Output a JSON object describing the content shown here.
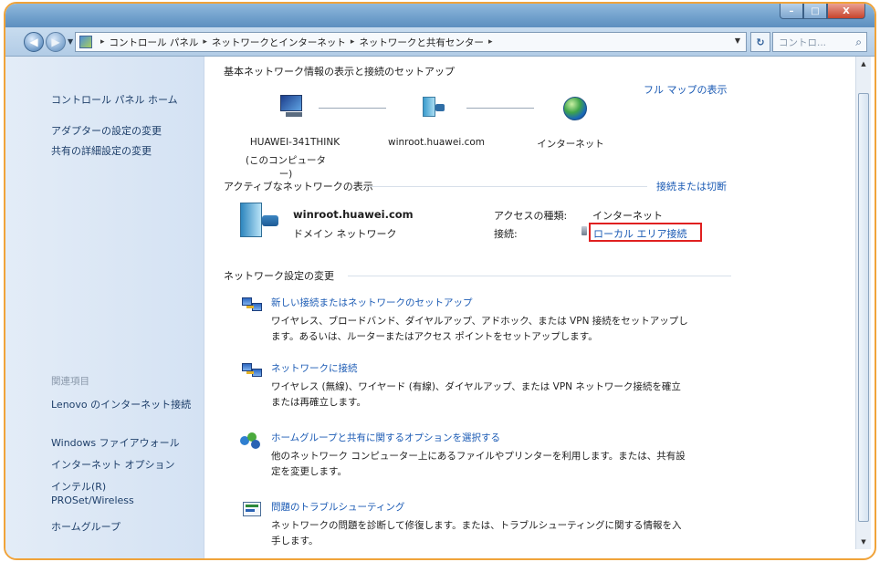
{
  "window": {
    "min_label": "–",
    "max_label": "□",
    "close_label": "X"
  },
  "address_bar": {
    "crumbs": [
      "コントロール パネル",
      "ネットワークとインターネット",
      "ネットワークと共有センター"
    ],
    "search_placeholder": "コントロ...",
    "refresh_symbol": "↻"
  },
  "sidebar": {
    "home": "コントロール パネル ホーム",
    "links": [
      "アダプターの設定の変更",
      "共有の詳細設定の変更"
    ],
    "related_heading": "関連項目",
    "related": [
      "Lenovo のインターネット接続",
      "Windows ファイアウォール",
      "インターネット オプション",
      "インテル(R) PROSet/Wireless",
      "ホームグループ"
    ]
  },
  "main": {
    "heading": "基本ネットワーク情報の表示と接続のセットアップ",
    "full_map": "フル マップの表示",
    "nodes": {
      "computer_name": "HUAWEI-341THINK",
      "computer_sub": "(このコンピューター)",
      "domain": "winroot.huawei.com",
      "internet": "インターネット"
    },
    "active_title": "アクティブなネットワークの表示",
    "connect_disconnect": "接続または切断",
    "network": {
      "name": "winroot.huawei.com",
      "type": "ドメイン ネットワーク",
      "access_label": "アクセスの種類:",
      "access_value": "インターネット",
      "conn_label": "接続:",
      "conn_value": "ローカル エリア接続"
    },
    "change_title": "ネットワーク設定の変更",
    "tasks": [
      {
        "link": "新しい接続またはネットワークのセットアップ",
        "desc1": "ワイヤレス、ブロードバンド、ダイヤルアップ、アドホック、または VPN 接続をセットアップし",
        "desc2": "ます。あるいは、ルーターまたはアクセス ポイントをセットアップします。"
      },
      {
        "link": "ネットワークに接続",
        "desc1": "ワイヤレス (無線)、ワイヤード (有線)、ダイヤルアップ、または VPN ネットワーク接続を確立",
        "desc2": "または再確立します。"
      },
      {
        "link": "ホームグループと共有に関するオプションを選択する",
        "desc1": "他のネットワーク コンピューター上にあるファイルやプリンターを利用します。または、共有設",
        "desc2": "定を変更します。"
      },
      {
        "link": "問題のトラブルシューティング",
        "desc1": "ネットワークの問題を診断して修復します。または、トラブルシューティングに関する情報を入",
        "desc2": "手します。"
      }
    ]
  },
  "colors": {
    "frame_border": "#f0a33a",
    "link": "#1a5ab4",
    "highlight_box": "#e02020"
  }
}
